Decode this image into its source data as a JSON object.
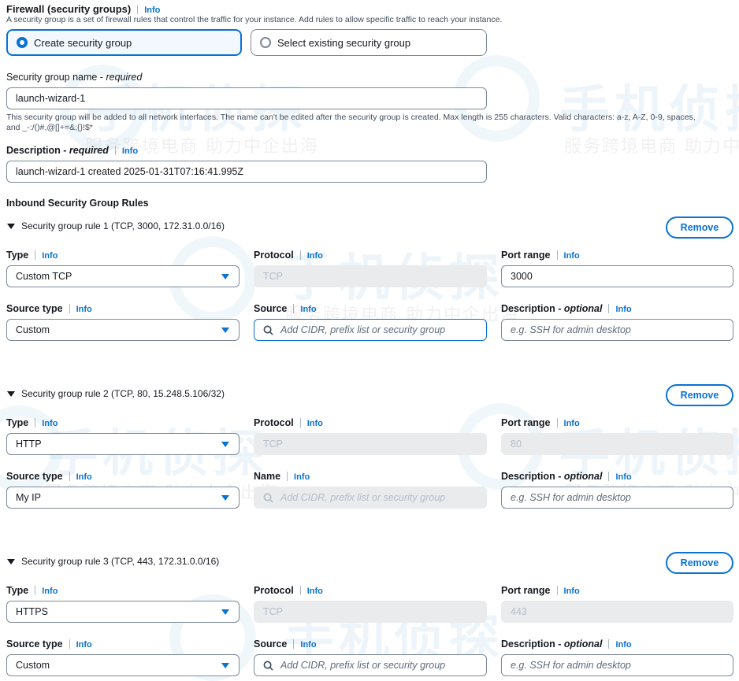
{
  "firewall": {
    "title": "Firewall (security groups)",
    "info": "Info",
    "description": "A security group is a set of firewall rules that control the traffic for your instance. Add rules to allow specific traffic to reach your instance.",
    "option_create": "Create security group",
    "option_select": "Select existing security group"
  },
  "sg_name": {
    "label": "Security group name - ",
    "required": "required",
    "value": "launch-wizard-1",
    "help_line1": "This security group will be added to all network interfaces. The name can't be edited after the security group is created. Max length is 255 characters. Valid characters: a-z, A-Z, 0-9, spaces,",
    "help_line2": "and _-:/()#,@[]+=&;{}!$*"
  },
  "sg_description": {
    "label": "Description - ",
    "required": "required",
    "info": "Info",
    "value": "launch-wizard-1 created 2025-01-31T07:16:41.995Z"
  },
  "inbound_title": "Inbound Security Group Rules",
  "labels": {
    "type": "Type",
    "protocol": "Protocol",
    "port_range": "Port range",
    "source_type": "Source type",
    "source": "Source",
    "name": "Name",
    "description": "Description - ",
    "optional": "optional",
    "info": "Info",
    "remove": "Remove",
    "source_placeholder": "Add CIDR, prefix list or security group",
    "desc_placeholder": "e.g. SSH for admin desktop"
  },
  "rules": [
    {
      "heading": "Security group rule 1 (TCP, 3000, 172.31.0.0/16)",
      "type": "Custom TCP",
      "protocol": "TCP",
      "port": "3000",
      "source_type": "Custom"
    },
    {
      "heading": "Security group rule 2 (TCP, 80, 15.248.5.106/32)",
      "type": "HTTP",
      "protocol": "TCP",
      "port": "80",
      "source_type": "My IP"
    },
    {
      "heading": "Security group rule 3 (TCP, 443, 172.31.0.0/16)",
      "type": "HTTPS",
      "protocol": "TCP",
      "port": "443",
      "source_type": "Custom"
    }
  ],
  "watermark": {
    "big": "手机侦探",
    "small": "服务跨境电商 助力中企出海"
  },
  "colors": {
    "accent": "#0972d3",
    "disabled_bg": "#e9ebed",
    "border": "#7d8998"
  }
}
